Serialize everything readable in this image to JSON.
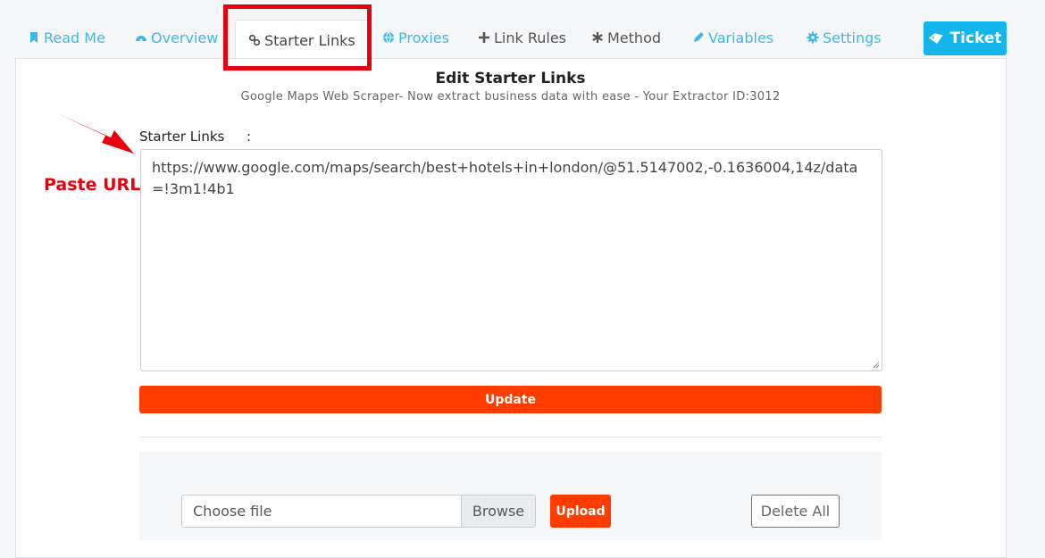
{
  "tabs": [
    {
      "label": "Read Me",
      "icon": "bookmark-icon"
    },
    {
      "label": "Overview",
      "icon": "dashboard-icon"
    },
    {
      "label": "Starter Links",
      "icon": "link-icon"
    },
    {
      "label": "Proxies",
      "icon": "globe-icon"
    },
    {
      "label": "Link Rules",
      "icon": "plus-icon"
    },
    {
      "label": "Method",
      "icon": "asterisk-icon"
    },
    {
      "label": "Variables",
      "icon": "pencil-icon"
    },
    {
      "label": "Settings",
      "icon": "gear-icon"
    }
  ],
  "ticket": {
    "label": "Ticket",
    "icon": "ticket-icon"
  },
  "page": {
    "title": "Edit Starter Links",
    "subtitle": "Google Maps Web Scraper- Now extract business data with ease - Your Extractor ID:3012"
  },
  "annotation": {
    "label": "Paste URL",
    "color": "#e8000d"
  },
  "form": {
    "field_label": "Starter Links",
    "field_colon": ":",
    "textarea_value": "https://www.google.com/maps/search/best+hotels+in+london/@51.5147002,-0.1636004,14z/data=!3m1!4b1",
    "update_label": "Update"
  },
  "upload": {
    "file_placeholder": "Choose file",
    "browse_label": "Browse",
    "upload_label": "Upload",
    "delete_all_label": "Delete All"
  },
  "colors": {
    "accent": "#14b5ea",
    "tab_link": "#3fb8e8",
    "primary_button": "#ff3d00",
    "highlight": "#e8000d"
  }
}
